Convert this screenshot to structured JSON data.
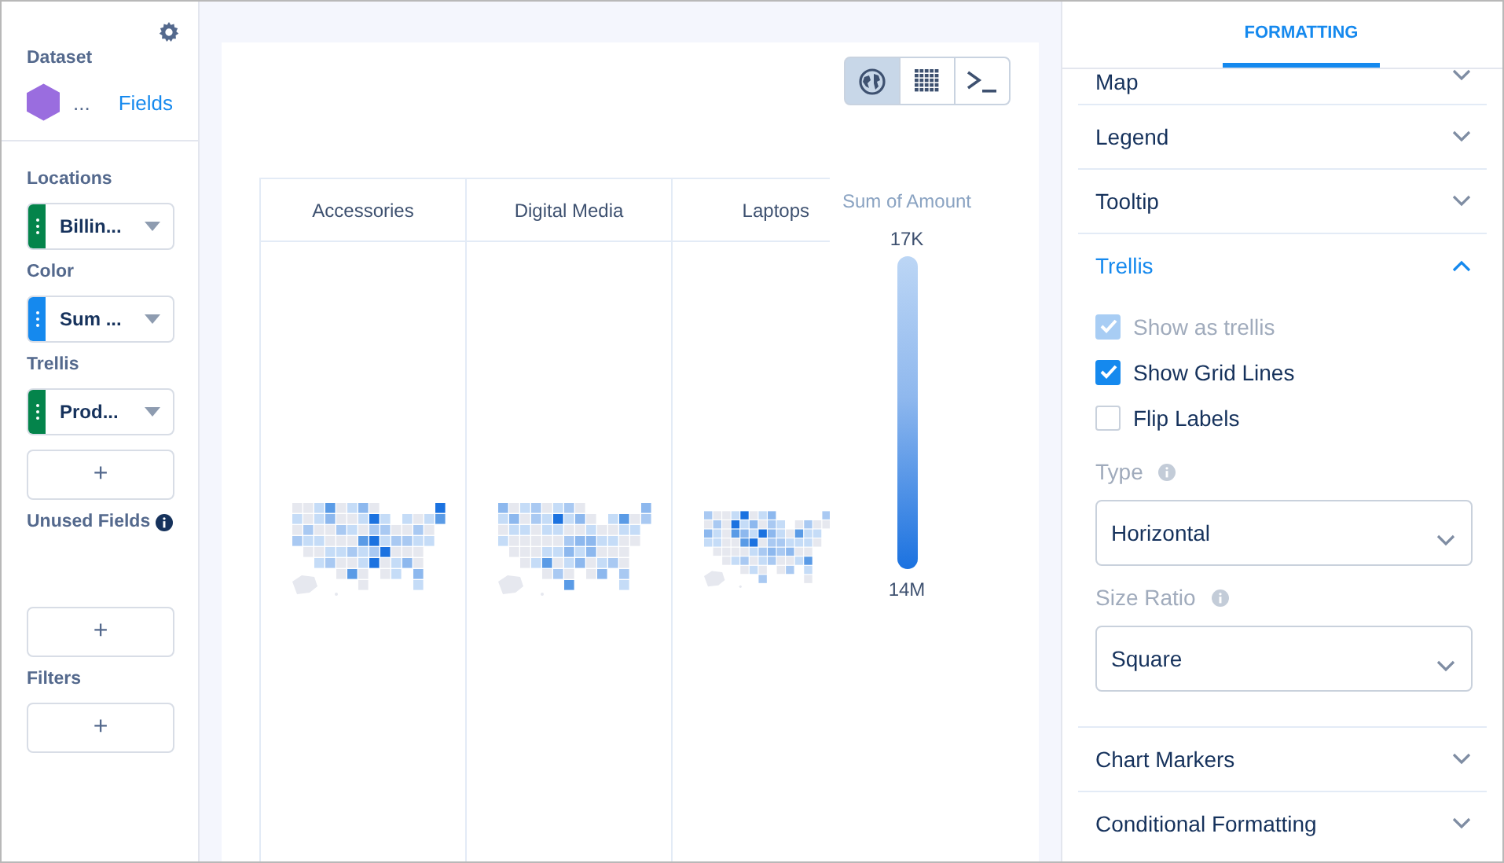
{
  "sidebar": {
    "dataset": {
      "label": "Dataset",
      "name": "...",
      "link": "Fields"
    },
    "sections": [
      {
        "label": "Locations",
        "pills": [
          {
            "name": "Billin...",
            "color": "#04844b"
          }
        ]
      },
      {
        "label": "Color",
        "pills": [
          {
            "name": "Sum ...",
            "color": "#1589ee"
          }
        ]
      },
      {
        "label": "Trellis",
        "pills": [
          {
            "name": "Prod...",
            "color": "#04844b"
          }
        ],
        "add": "+"
      },
      {
        "label": "Unused Fields",
        "info": true,
        "add": "+"
      },
      {
        "label": "Filters",
        "add": "+"
      }
    ]
  },
  "view_toggles": [
    {
      "kind": "map",
      "selected": true
    },
    {
      "kind": "table",
      "selected": false
    },
    {
      "kind": "query",
      "selected": false
    }
  ],
  "trellis": {
    "columns": [
      {
        "label": "Accessories"
      },
      {
        "label": "Digital Media"
      },
      {
        "label": "Laptops"
      }
    ]
  },
  "legend": {
    "title": "Sum of Amount",
    "max": "17K",
    "min": "14M"
  },
  "panel": {
    "tabs": [
      {
        "label": "FORMATTING",
        "selected": true
      }
    ],
    "sections": [
      {
        "label": "Map",
        "expanded": false
      },
      {
        "label": "Legend",
        "expanded": false
      },
      {
        "label": "Tooltip",
        "expanded": false
      },
      {
        "label": "Trellis",
        "expanded": true,
        "checkboxes": [
          {
            "label": "Show as trellis",
            "checked": true,
            "disabled": true
          },
          {
            "label": "Show Grid Lines",
            "checked": true,
            "disabled": false
          },
          {
            "label": "Flip Labels",
            "checked": false,
            "disabled": false
          }
        ],
        "selects": [
          {
            "label": "Type",
            "value": "Horizontal"
          },
          {
            "label": "Size Ratio",
            "value": "Square"
          }
        ]
      },
      {
        "label": "Chart Markers",
        "expanded": false
      },
      {
        "label": "Conditional Formatting",
        "expanded": false
      }
    ]
  }
}
